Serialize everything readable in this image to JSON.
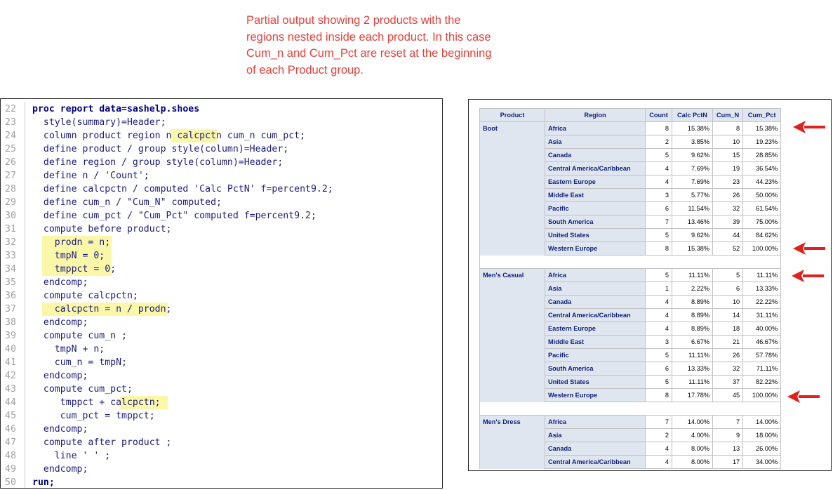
{
  "annotation": {
    "lines": [
      "Partial output showing 2 products with the",
      "regions nested inside each product. In this case",
      "Cum_n and Cum_Pct are reset at the beginning",
      "of each Product group."
    ]
  },
  "code": {
    "lines": [
      {
        "n": "22",
        "t": "proc report data=sashelp.shoes"
      },
      {
        "n": "23",
        "t": "  style(summary)=Header;"
      },
      {
        "n": "24",
        "t": "  column product region n calcpctn cum_n cum_pct;"
      },
      {
        "n": "25",
        "t": "  define product / group style(column)=Header;"
      },
      {
        "n": "26",
        "t": "  define region / group style(column)=Header;"
      },
      {
        "n": "27",
        "t": "  define n / 'Count';"
      },
      {
        "n": "28",
        "t": "  define calcpctn / computed 'Calc PctN' f=percent9.2;"
      },
      {
        "n": "29",
        "t": "  define cum_n / \"Cum_N\" computed;"
      },
      {
        "n": "30",
        "t": "  define cum_pct / \"Cum_Pct\" computed f=percent9.2;"
      },
      {
        "n": "31",
        "t": "  compute before product;"
      },
      {
        "n": "32",
        "t": "    prodn = n;"
      },
      {
        "n": "33",
        "t": "    tmpN = 0;"
      },
      {
        "n": "34",
        "t": "    tmppct = 0;"
      },
      {
        "n": "35",
        "t": "  endcomp;"
      },
      {
        "n": "36",
        "t": "  compute calcpctn;"
      },
      {
        "n": "37",
        "t": "    calcpctn = n / prodn;"
      },
      {
        "n": "38",
        "t": "  endcomp;"
      },
      {
        "n": "39",
        "t": "  compute cum_n ;"
      },
      {
        "n": "40",
        "t": "    tmpN + n;"
      },
      {
        "n": "41",
        "t": "    cum_n = tmpN;"
      },
      {
        "n": "42",
        "t": "  endcomp;"
      },
      {
        "n": "43",
        "t": "  compute cum_pct;"
      },
      {
        "n": "44",
        "t": "     tmppct + calcpctn;"
      },
      {
        "n": "45",
        "t": "     cum_pct = tmppct;"
      },
      {
        "n": "46",
        "t": "  endcomp;"
      },
      {
        "n": "47",
        "t": "  compute after product ;"
      },
      {
        "n": "48",
        "t": "    line ' ' ;"
      },
      {
        "n": "49",
        "t": "  endcomp;"
      },
      {
        "n": "50",
        "t": "run;"
      }
    ]
  },
  "report": {
    "headers": [
      "Product",
      "Region",
      "Count",
      "Calc PctN",
      "Cum_N",
      "Cum_Pct"
    ],
    "groups": [
      {
        "product": "Boot",
        "rows": [
          [
            "Africa",
            "8",
            "15.38%",
            "8",
            "15.38%"
          ],
          [
            "Asia",
            "2",
            "3.85%",
            "10",
            "19.23%"
          ],
          [
            "Canada",
            "5",
            "9.62%",
            "15",
            "28.85%"
          ],
          [
            "Central America/Caribbean",
            "4",
            "7.69%",
            "19",
            "36.54%"
          ],
          [
            "Eastern Europe",
            "4",
            "7.69%",
            "23",
            "44.23%"
          ],
          [
            "Middle East",
            "3",
            "5.77%",
            "26",
            "50.00%"
          ],
          [
            "Pacific",
            "6",
            "11.54%",
            "32",
            "61.54%"
          ],
          [
            "South America",
            "7",
            "13.46%",
            "39",
            "75.00%"
          ],
          [
            "United States",
            "5",
            "9.62%",
            "44",
            "84.62%"
          ],
          [
            "Western Europe",
            "8",
            "15.38%",
            "52",
            "100.00%"
          ]
        ]
      },
      {
        "product": "Men's Casual",
        "rows": [
          [
            "Africa",
            "5",
            "11.11%",
            "5",
            "11.11%"
          ],
          [
            "Asia",
            "1",
            "2.22%",
            "6",
            "13.33%"
          ],
          [
            "Canada",
            "4",
            "8.89%",
            "10",
            "22.22%"
          ],
          [
            "Central America/Caribbean",
            "4",
            "8.89%",
            "14",
            "31.11%"
          ],
          [
            "Eastern Europe",
            "4",
            "8.89%",
            "18",
            "40.00%"
          ],
          [
            "Middle East",
            "3",
            "6.67%",
            "21",
            "46.67%"
          ],
          [
            "Pacific",
            "5",
            "11.11%",
            "26",
            "57.78%"
          ],
          [
            "South America",
            "6",
            "13.33%",
            "32",
            "71.11%"
          ],
          [
            "United States",
            "5",
            "11.11%",
            "37",
            "82.22%"
          ],
          [
            "Western Europe",
            "8",
            "17.78%",
            "45",
            "100.00%"
          ]
        ]
      },
      {
        "product": "Men's Dress",
        "rows": [
          [
            "Africa",
            "7",
            "14.00%",
            "7",
            "14.00%"
          ],
          [
            "Asia",
            "2",
            "4.00%",
            "9",
            "18.00%"
          ],
          [
            "Canada",
            "4",
            "8.00%",
            "13",
            "26.00%"
          ],
          [
            "Central America/Caribbean",
            "4",
            "8.00%",
            "17",
            "34.00%"
          ]
        ]
      }
    ]
  },
  "colors": {
    "annotation": "#e8403a",
    "highlight": "#fbf7a8",
    "header_bg": "#e0e6f0",
    "header_text": "#112277",
    "arrow": "#e0201c"
  }
}
